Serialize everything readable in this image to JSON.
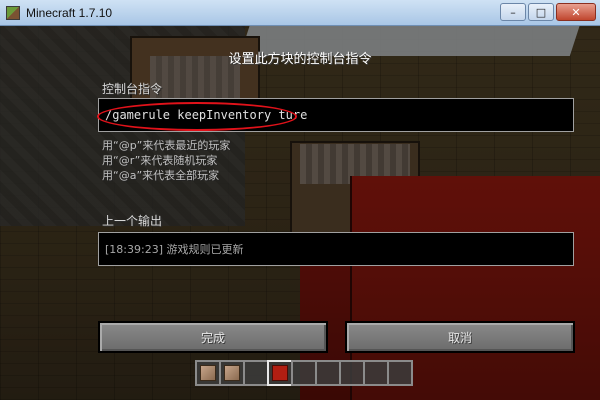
{
  "window": {
    "title": "Minecraft 1.7.10",
    "controls": {
      "minimize_label": "–",
      "maximize_label": "□",
      "close_label": "✕"
    }
  },
  "gui": {
    "title": "设置此方块的控制台指令",
    "command_label": "控制台指令",
    "command_value": "/gamerule keepInventory ture",
    "hints": [
      "用“@p”来代表最近的玩家",
      "用“@r”来代表随机玩家",
      "用“@a”来代表全部玩家"
    ],
    "previous_output_label": "上一个输出",
    "previous_output_value": "[18:39:23] 游戏规则已更新",
    "done_button": "完成",
    "cancel_button": "取消"
  },
  "annotation": {
    "highlight_color": "#e1121a"
  },
  "hotbar": {
    "slots": [
      {
        "item": "command-block-icon"
      },
      {
        "item": "command-block-icon"
      },
      {
        "item": ""
      },
      {
        "item": "redstone-block-icon",
        "selected": true
      },
      {
        "item": ""
      },
      {
        "item": ""
      },
      {
        "item": ""
      },
      {
        "item": ""
      },
      {
        "item": ""
      }
    ]
  }
}
